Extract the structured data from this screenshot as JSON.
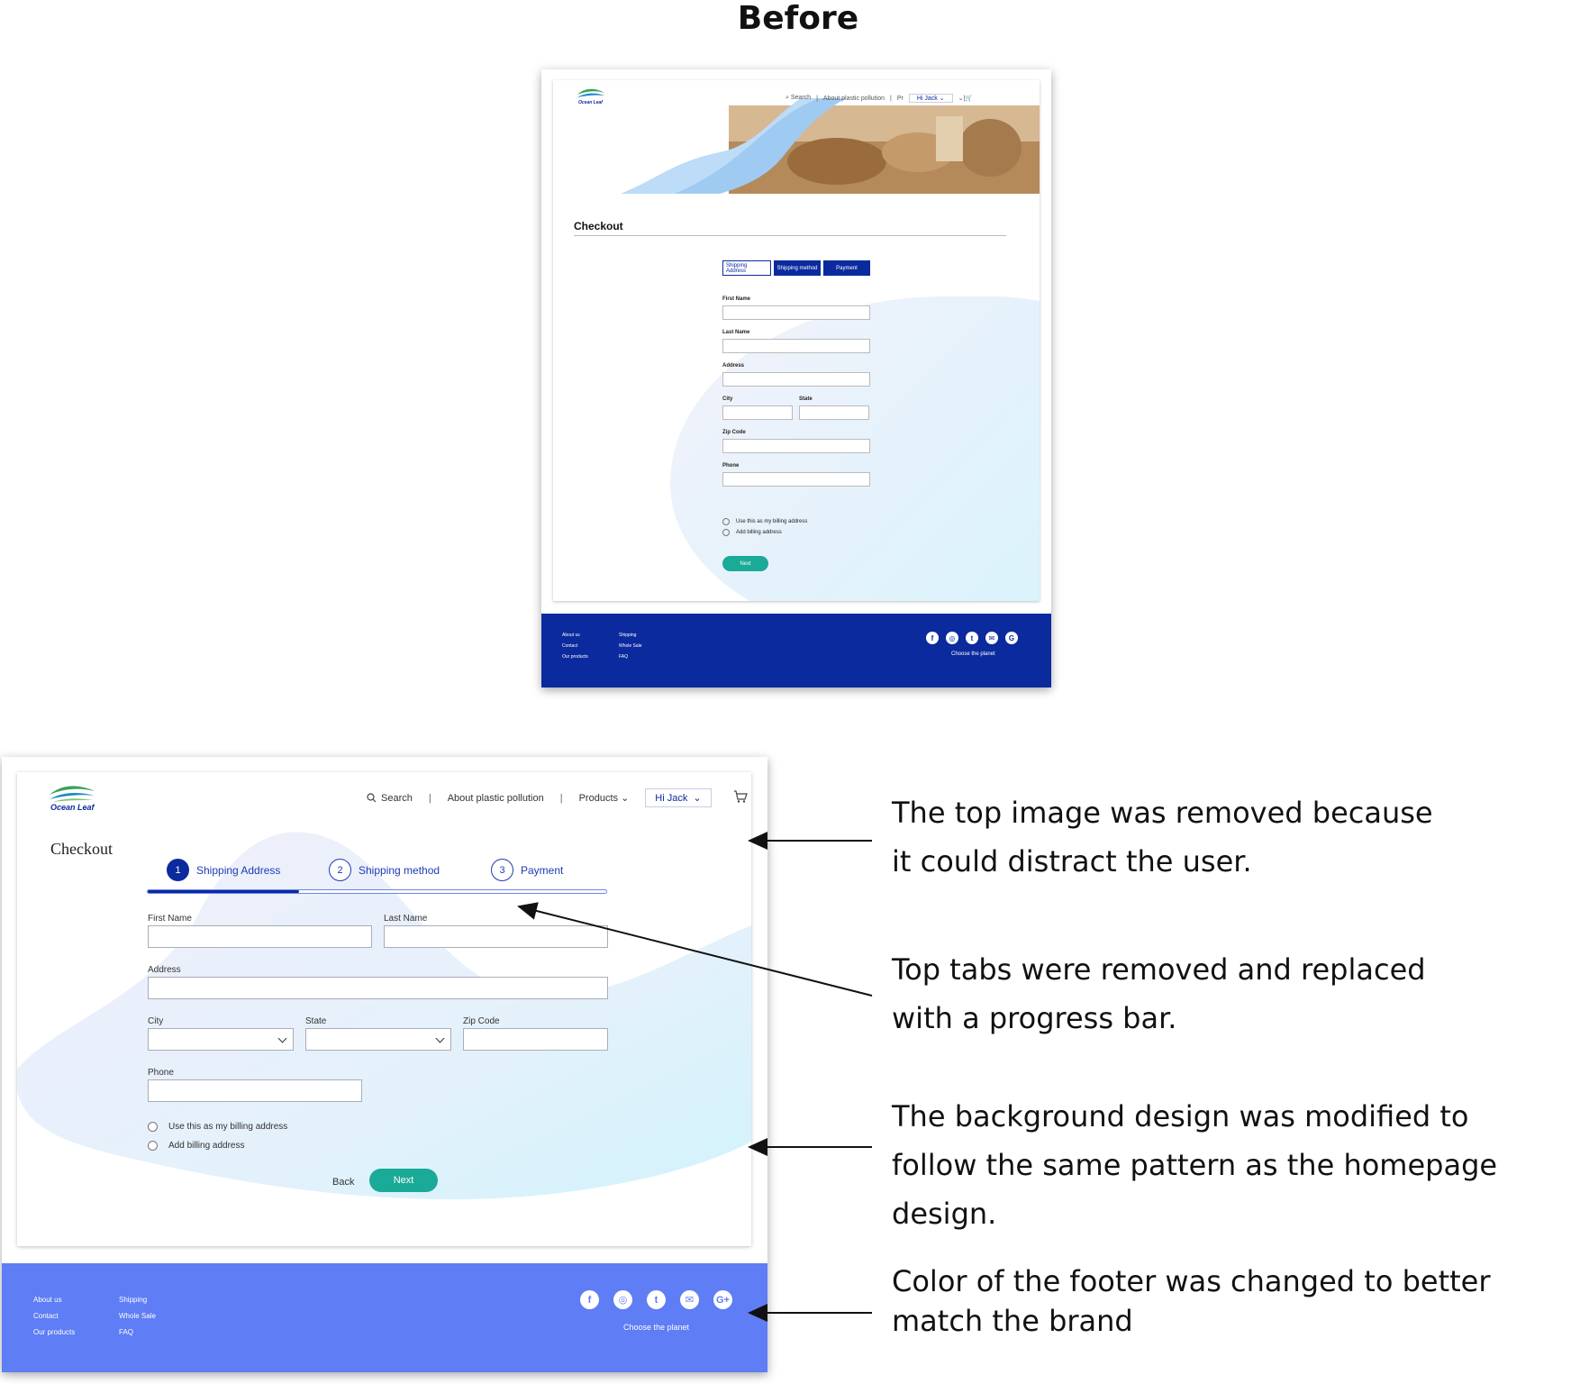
{
  "heading": "Before",
  "brand": {
    "logo_text": "Ocean Leaf",
    "primary": "#0b2a9e",
    "accent": "#1aaa98",
    "footer_after": "#5f7df4"
  },
  "before": {
    "nav": {
      "search": "Search",
      "about": "About plastic pollution",
      "products": "Pr",
      "user": "Hi Jack"
    },
    "title": "Checkout",
    "tabs": [
      "Shipping Address",
      "Shipping method",
      "Payment"
    ],
    "fields": {
      "first_name": "First Name",
      "last_name": "Last Name",
      "address": "Address",
      "city": "City",
      "state": "State",
      "zip": "Zip Code",
      "phone": "Phone"
    },
    "radios": [
      "Use this as my billing address",
      "Add billing address"
    ],
    "next": "Next",
    "footer": {
      "col1": [
        "About us",
        "Contact",
        "Our products"
      ],
      "col2": [
        "Shipping",
        "Whole Sale",
        "FAQ"
      ],
      "tagline": "Choose the planet"
    }
  },
  "after": {
    "nav": {
      "search": "Search",
      "about": "About plastic pollution",
      "products": "Products",
      "user": "Hi Jack",
      "separator": "|"
    },
    "title": "Checkout",
    "steps": [
      {
        "num": "1",
        "label": "Shipping Address"
      },
      {
        "num": "2",
        "label": "Shipping method"
      },
      {
        "num": "3",
        "label": "Payment"
      }
    ],
    "progress_fraction": 0.33,
    "fields": {
      "first_name": "First Name",
      "last_name": "Last Name",
      "address": "Address",
      "city": "City",
      "state": "State",
      "zip": "Zip Code",
      "phone": "Phone"
    },
    "radios": [
      "Use this as my billing address",
      "Add billing address"
    ],
    "back": "Back",
    "next": "Next",
    "footer": {
      "col1": [
        "About us",
        "Contact",
        "Our products"
      ],
      "col2": [
        "Shipping",
        "Whole Sale",
        "FAQ"
      ],
      "tagline": "Choose the planet"
    }
  },
  "social_icons": [
    "facebook-icon",
    "instagram-icon",
    "twitter-icon",
    "mail-icon",
    "google-plus-icon"
  ],
  "notes": [
    {
      "line1": "The top image was removed because",
      "line2": "it could distract the user."
    },
    {
      "line1": "Top tabs were removed and replaced",
      "line2": "with a progress bar."
    },
    {
      "line1": "The background design was modified to",
      "line2": "follow the same pattern as the homepage",
      "line3": "design."
    },
    {
      "line1": "Color of the footer was changed to better",
      "line2": "match the brand"
    }
  ]
}
